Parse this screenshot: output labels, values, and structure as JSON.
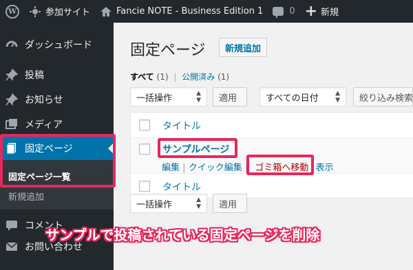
{
  "adminbar": {
    "site_name": "参加サイト",
    "site2_name": "Fancie NOTE - Business Edition 1",
    "comments_count": "0",
    "new_label": "新規"
  },
  "sidebar": {
    "items": [
      {
        "label": "ダッシュボード",
        "icon": "dashboard-icon"
      },
      {
        "label": "投稿",
        "icon": "pin-icon"
      },
      {
        "label": "お知らせ",
        "icon": "pin-icon"
      },
      {
        "label": "メディア",
        "icon": "media-icon"
      },
      {
        "label": "固定ページ",
        "icon": "page-icon"
      },
      {
        "label": "コメント",
        "icon": "comment-icon"
      },
      {
        "label": "お問い合わせ",
        "icon": "mail-icon"
      }
    ],
    "submenu": [
      "固定ページ一覧",
      "新規追加"
    ]
  },
  "main": {
    "title": "固定ページ",
    "add_new": "新規追加",
    "filter_all": "すべて",
    "filter_all_count": "(1)",
    "filter_published": "公開済み",
    "filter_published_count": "(1)",
    "bulk_action": "一括操作",
    "apply": "適用",
    "all_dates": "すべての日付",
    "filter_button": "絞り込み検索",
    "header_title": "タイトル",
    "footer_title": "タイトル",
    "row_title": "サンプルページ",
    "actions": {
      "edit": "編集",
      "quick_edit": "クイック編集",
      "trash": "ゴミ箱へ移動",
      "view": "表示"
    },
    "sep": "|"
  },
  "caption": "サンプルで投稿されている固定ページを削除",
  "colors": {
    "accent": "#0073aa",
    "highlight": "#e8275a",
    "sidebar": "#23282d"
  }
}
